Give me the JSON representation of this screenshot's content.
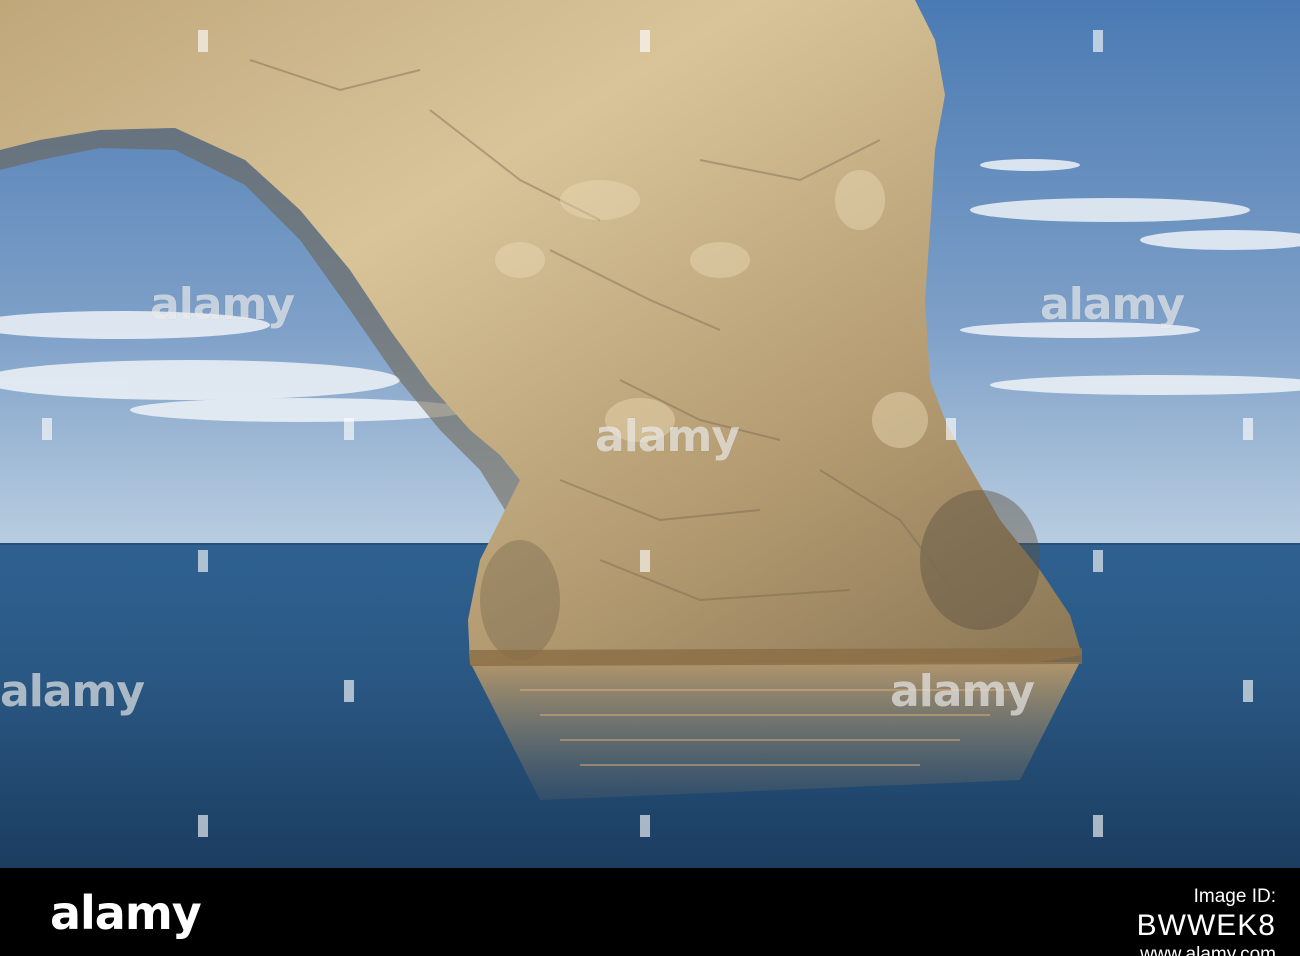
{
  "watermark": {
    "text": "alamy"
  },
  "footer": {
    "logo": "alamy",
    "image_id_label": "Image ID:",
    "image_id": "BWWEK8",
    "url": "www.alamy.com"
  },
  "colors": {
    "sky_top": "#4f7fb6",
    "sky_horizon": "#b9cde0",
    "sea_top": "#2b5a86",
    "sea_bottom": "#1c3f63",
    "rock_light": "#d8c49a",
    "rock_shadow": "#6e604a",
    "footer_bg": "#000000"
  }
}
